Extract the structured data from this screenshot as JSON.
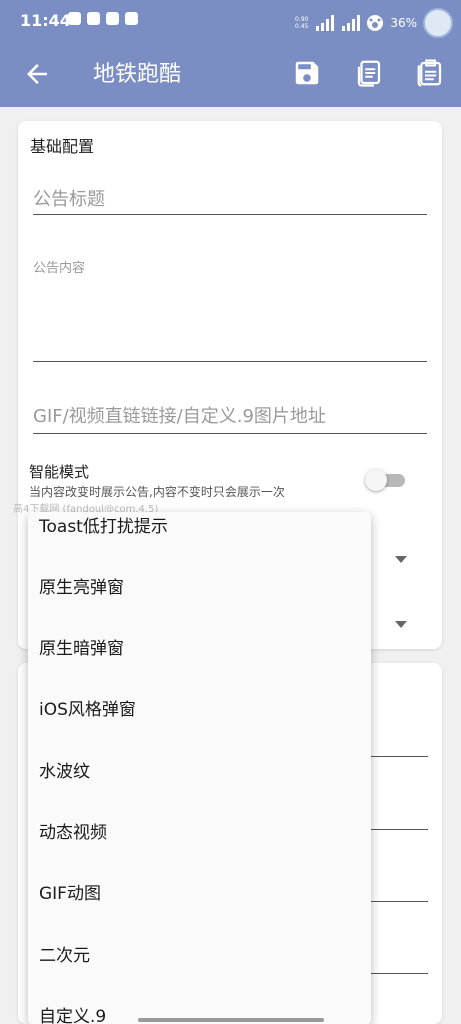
{
  "status_bar": {
    "time": "11:44",
    "net_speed_top": "0.90",
    "net_speed_bottom": "0.45",
    "signal1": "4G",
    "signal2": "4G",
    "battery": "36%"
  },
  "app_bar": {
    "title": "地铁跑酷",
    "back_icon": "arrow-back-icon",
    "actions": [
      "save-icon",
      "copy-icon",
      "paste-icon"
    ]
  },
  "card1": {
    "section_title": "基础配置",
    "title_placeholder": "公告标题",
    "content_placeholder": "公告内容",
    "media_placeholder": "GIF/视频直链链接/自定义.9图片地址",
    "smart_mode": {
      "title": "智能模式",
      "description": "当内容改变时展示公告,内容不变时只会展示一次",
      "enabled": false
    }
  },
  "watermark": "高4下载网 (fandoul@com.4.5)",
  "dropdown": {
    "items": [
      "Toast低打扰提示",
      "原生亮弹窗",
      "原生暗弹窗",
      "iOS风格弹窗",
      "水波纹",
      "动态视频",
      "GIF动图",
      "二次元",
      "自定义.9"
    ]
  },
  "colors": {
    "app_bar": "#7b8ec4",
    "background": "#f0f0f0",
    "card": "#ffffff",
    "menu": "#fafafa"
  }
}
